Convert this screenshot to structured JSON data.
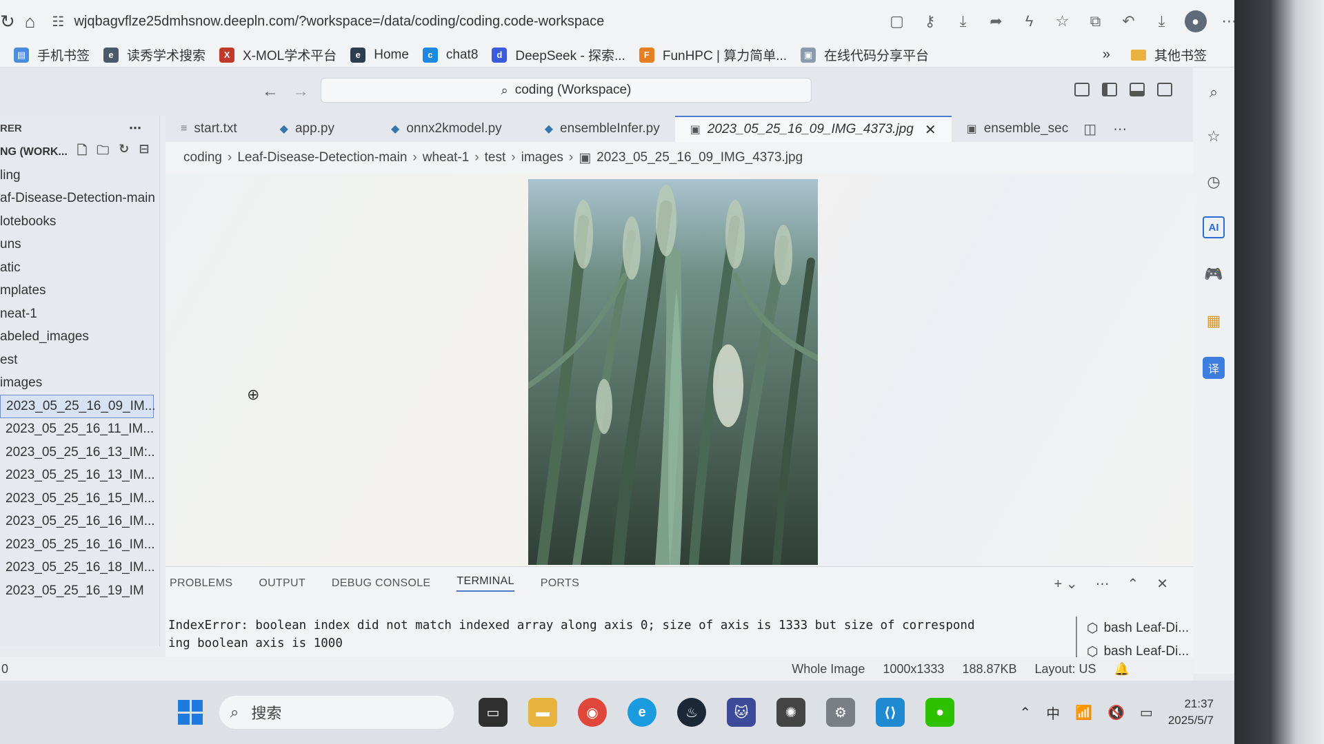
{
  "browser": {
    "url": "wjqbagvflze25dmhsnow.deepln.com/?workspace=/data/coding/coding.code-workspace",
    "bookmarks": [
      {
        "label": "手机书签",
        "icon": "bookmark-icon",
        "color": "#4a8be0"
      },
      {
        "label": "读秀学术搜索",
        "icon": "duxiu-icon",
        "color": "#4a5a6a"
      },
      {
        "label": "X-MOL学术平台",
        "icon": "xmol-icon",
        "color": "#c0392b"
      },
      {
        "label": "Home",
        "icon": "home-e-icon",
        "color": "#2c3e50"
      },
      {
        "label": "chat8",
        "icon": "chat-icon",
        "color": "#1e88e5"
      },
      {
        "label": "DeepSeek - 探索...",
        "icon": "deepseek-icon",
        "color": "#3b5bdb"
      },
      {
        "label": "FunHPC | 算力简单...",
        "icon": "funhpc-icon",
        "color": "#e67e22"
      },
      {
        "label": "在线代码分享平台",
        "icon": "code-share-icon",
        "color": "#8a9bb0"
      }
    ],
    "bookmarks_more": "»",
    "other_bookmarks": "其他书签"
  },
  "vscode": {
    "command_center": "coding (Workspace)",
    "explorer": {
      "header": "RER",
      "workspace": "NG (WORK...",
      "tree": [
        {
          "label": "ling",
          "indent": 0
        },
        {
          "label": "af-Disease-Detection-main",
          "indent": 0
        },
        {
          "label": "lotebooks",
          "indent": 0
        },
        {
          "label": "uns",
          "indent": 0
        },
        {
          "label": "atic",
          "indent": 0
        },
        {
          "label": "mplates",
          "indent": 0
        },
        {
          "label": "neat-1",
          "indent": 0
        },
        {
          "label": "abeled_images",
          "indent": 0
        },
        {
          "label": "est",
          "indent": 0
        },
        {
          "label": "images",
          "indent": 0
        }
      ],
      "files": [
        {
          "label": "2023_05_25_16_09_IM...",
          "active": true
        },
        {
          "label": "2023_05_25_16_11_IM...",
          "active": false
        },
        {
          "label": "2023_05_25_16_13_IM:..",
          "active": false
        },
        {
          "label": "2023_05_25_16_13_IM...",
          "active": false
        },
        {
          "label": "2023_05_25_16_15_IM...",
          "active": false
        },
        {
          "label": "2023_05_25_16_16_IM...",
          "active": false
        },
        {
          "label": "2023_05_25_16_16_IM...",
          "active": false
        },
        {
          "label": "2023_05_25_16_18_IM...",
          "active": false
        },
        {
          "label": "2023_05_25_16_19_IM",
          "active": false
        }
      ]
    },
    "tabs": [
      {
        "label": "start.txt",
        "icon": "text-file-icon",
        "active": false
      },
      {
        "label": "app.py",
        "icon": "python-file-icon",
        "active": false
      },
      {
        "label": "onnx2kmodel.py",
        "icon": "python-file-icon",
        "active": false
      },
      {
        "label": "ensembleInfer.py",
        "icon": "python-file-icon",
        "active": false
      },
      {
        "label": "2023_05_25_16_09_IMG_4373.jpg",
        "icon": "image-file-icon",
        "active": true
      },
      {
        "label": "ensemble_sec",
        "icon": "image-file-icon",
        "active": false
      }
    ],
    "breadcrumb": [
      "coding",
      "Leaf-Disease-Detection-main",
      "wheat-1",
      "test",
      "images",
      "2023_05_25_16_09_IMG_4373.jpg"
    ],
    "panel": {
      "tabs": [
        "PROBLEMS",
        "OUTPUT",
        "DEBUG CONSOLE",
        "TERMINAL",
        "PORTS"
      ],
      "active_tab": "TERMINAL",
      "terminal_text": "IndexError: boolean index did not match indexed array along axis 0; size of axis is 1333 but size of correspond\ning boolean axis is 1000",
      "terminals": [
        "bash Leaf-Di...",
        "bash Leaf-Di..."
      ]
    },
    "status": {
      "left": "0",
      "whole_image": "Whole Image",
      "dimensions": "1000x1333",
      "size": "188.87KB",
      "layout": "Layout: US"
    }
  },
  "taskbar": {
    "search_placeholder": "搜索",
    "apps": [
      {
        "name": "task-view-icon",
        "color": "#2f2f2f"
      },
      {
        "name": "file-explorer-icon",
        "color": "#e8b33e"
      },
      {
        "name": "chrome-icon",
        "color": "#e0463a"
      },
      {
        "name": "edge-icon",
        "color": "#1a9be0"
      },
      {
        "name": "steam-icon",
        "color": "#1b2838"
      },
      {
        "name": "cat-app-icon",
        "color": "#3b4b9a"
      },
      {
        "name": "openai-icon",
        "color": "#444"
      },
      {
        "name": "tool-app-icon",
        "color": "#7a7f86"
      },
      {
        "name": "vscode-icon",
        "color": "#1f8ad2"
      },
      {
        "name": "wechat-icon",
        "color": "#2dc100"
      }
    ],
    "ime": "中",
    "time": "21:37",
    "date": "2025/5/7"
  }
}
